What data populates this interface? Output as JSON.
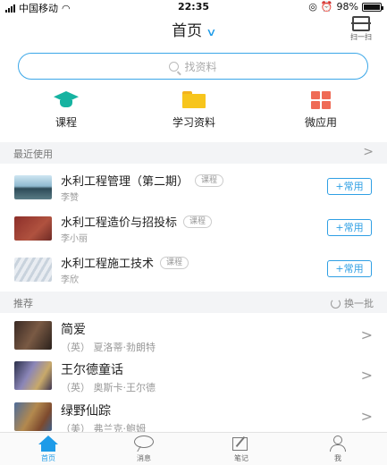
{
  "status_bar": {
    "carrier": "中国移动",
    "time": "22:35",
    "battery_text": "98%",
    "battery_level": 0.98
  },
  "header": {
    "title": "首页",
    "scan_label": "扫一扫"
  },
  "search": {
    "placeholder": "找资料"
  },
  "quick_actions": [
    {
      "label": "课程",
      "icon": "graduation-cap-icon"
    },
    {
      "label": "学习资料",
      "icon": "folder-icon"
    },
    {
      "label": "微应用",
      "icon": "app-grid-icon"
    }
  ],
  "recent": {
    "section_title": "最近使用",
    "items": [
      {
        "title": "水利工程管理（第二期）",
        "tag": "课程",
        "teacher": "李赞",
        "action": "+常用"
      },
      {
        "title": "水利工程造价与招投标",
        "tag": "课程",
        "teacher": "李小丽",
        "action": "+常用"
      },
      {
        "title": "水利工程施工技术",
        "tag": "课程",
        "teacher": "李欣",
        "action": "+常用"
      }
    ]
  },
  "recommend": {
    "section_title": "推荐",
    "refresh_label": "换一批",
    "items": [
      {
        "title": "简爱",
        "author": "（英） 夏洛蒂·勃朗特"
      },
      {
        "title": "王尔德童话",
        "author": "（英） 奥斯卡·王尔德"
      },
      {
        "title": "绿野仙踪",
        "author": "（美） 弗兰克·鲍姆"
      }
    ]
  },
  "tabbar": {
    "items": [
      {
        "label": "首页",
        "icon": "home-icon",
        "active": true
      },
      {
        "label": "消息",
        "icon": "message-icon",
        "active": false
      },
      {
        "label": "笔记",
        "icon": "note-icon",
        "active": false
      },
      {
        "label": "我",
        "icon": "profile-icon",
        "active": false
      }
    ]
  },
  "colors": {
    "accent": "#1e9be8",
    "course_icon": "#16b3a1",
    "folder_icon": "#f7c51c",
    "app_icon": "#ef6b56"
  }
}
